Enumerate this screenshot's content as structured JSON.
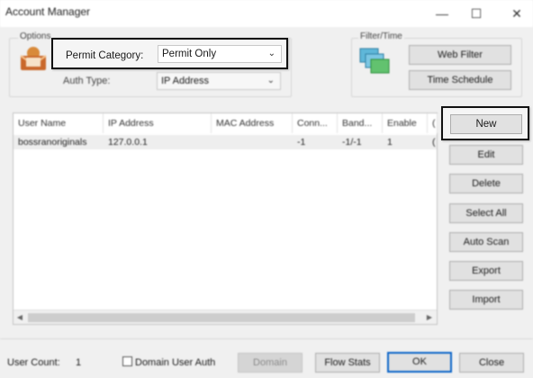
{
  "window": {
    "title": "Account Manager",
    "minimize_glyph": "—",
    "maximize_glyph": "☐",
    "close_glyph": "✕"
  },
  "options": {
    "label": "Options",
    "permit_category_label": "Permit Category:",
    "permit_category_value": "Permit Only",
    "auth_type_label": "Auth Type:",
    "auth_type_value": "IP Address"
  },
  "filter_time": {
    "label": "Filter/Time",
    "web_filter": "Web Filter",
    "time_schedule": "Time Schedule"
  },
  "table": {
    "columns": [
      "User Name",
      "IP Address",
      "MAC Address",
      "Conn...",
      "Band...",
      "Enable",
      "("
    ],
    "rows": [
      [
        "bossranoriginals",
        "127.0.0.1",
        "",
        "-1",
        "-1/-1",
        "1",
        "("
      ]
    ]
  },
  "side_buttons": {
    "new": "New",
    "edit": "Edit",
    "delete": "Delete",
    "select_all": "Select All",
    "auto_scan": "Auto Scan",
    "export": "Export",
    "import": "Import"
  },
  "footer": {
    "user_count_label": "User Count:",
    "user_count_value": "1",
    "domain_user_auth": "Domain User Auth",
    "domain": "Domain",
    "flow_stats": "Flow Stats",
    "ok": "OK",
    "close": "Close"
  },
  "icons": {
    "options": "envelope-user-icon",
    "filter": "monitors-icon"
  },
  "colors": {
    "highlight_border": "#111111",
    "primary_border": "#0a64c8"
  }
}
